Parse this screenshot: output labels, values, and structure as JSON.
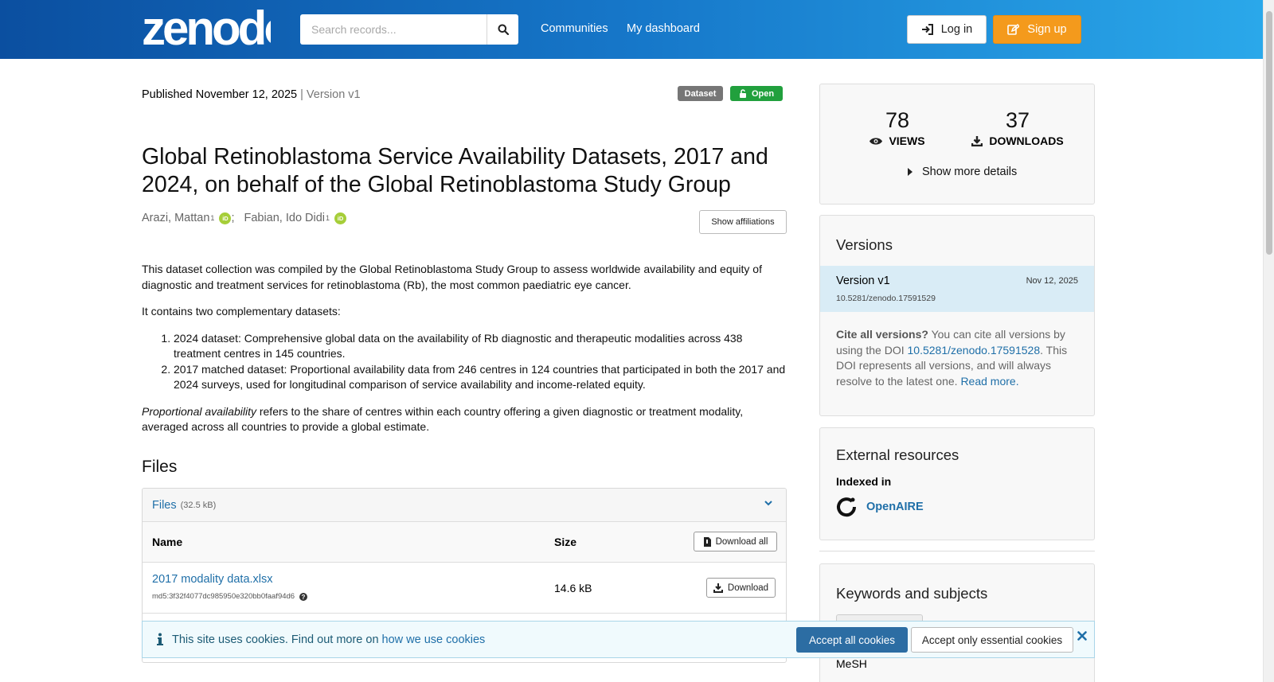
{
  "header": {
    "logo_text": "zenodo",
    "search_placeholder": "Search records...",
    "nav": [
      "Communities",
      "My dashboard"
    ],
    "login_label": "Log in",
    "signup_label": "Sign up"
  },
  "record": {
    "published_prefix": "Published",
    "published_date": "November 12, 2025",
    "version_text": "| Version v1",
    "badge_type": "Dataset",
    "badge_access": "Open",
    "title": "Global Retinoblastoma Service Availability Datasets, 2017 and 2024, on behalf of the Global Retinoblastoma Study Group",
    "creators": [
      {
        "name": "Arazi, Mattan",
        "affil": "1",
        "sep": ";"
      },
      {
        "name": "Fabian, Ido Didi",
        "affil": "1",
        "sep": ""
      }
    ],
    "show_affiliations_label": "Show affiliations",
    "description": {
      "p1": "This dataset collection was compiled by the Global Retinoblastoma Study Group to assess worldwide availability and equity of diagnostic and treatment services for retinoblastoma (Rb), the most common paediatric eye cancer.",
      "p2": "It contains two complementary datasets:",
      "list": [
        "2024 dataset: Comprehensive global data on the availability of Rb diagnostic and therapeutic modalities across 438 treatment centres in 145 countries.",
        "2017 matched dataset: Proportional availability data from 246 centres in 124 countries that participated in both the 2017 and 2024 surveys, used for longitudinal comparison of service availability and income-related equity."
      ],
      "p3_em": "Proportional availability",
      "p3_rest": " refers to the share of centres within each country offering a given diagnostic or treatment modality, averaged across all countries to provide a global estimate."
    }
  },
  "files": {
    "heading": "Files",
    "panel_label": "Files",
    "panel_size": "(32.5 kB)",
    "col_name": "Name",
    "col_size": "Size",
    "download_all_label": "Download all",
    "rows": [
      {
        "name": "2017 modality data.xlsx",
        "md5": "md5:3f32f4077dc985950e320bb0faaf94d6",
        "size": "14.6 kB",
        "download_label": "Download"
      }
    ]
  },
  "stats": {
    "views": "78",
    "views_label": "VIEWS",
    "downloads": "37",
    "downloads_label": "DOWNLOADS",
    "more_label": "Show more details"
  },
  "versions": {
    "heading": "Versions",
    "current_name": "Version v1",
    "current_date": "Nov 12, 2025",
    "current_doi": "10.5281/zenodo.17591529",
    "cite_bold": "Cite all versions?",
    "cite_text1": " You can cite all versions by using the DOI ",
    "cite_doi": "10.5281/zenodo.17591528",
    "cite_text2": ". This DOI represents all versions, and will always resolve to the latest one. ",
    "read_more": "Read more."
  },
  "external": {
    "heading": "External resources",
    "indexed_label": "Indexed in",
    "source_name": "OpenAIRE"
  },
  "keywords": {
    "heading": "Keywords and subjects",
    "mesh_label": "MeSH"
  },
  "cookie": {
    "text": "This site uses cookies. Find out more on ",
    "link": "how we use cookies",
    "accept_all": "Accept all cookies",
    "accept_essential": "Accept only essential cookies"
  },
  "colors": {
    "header_start": "#0b4fa0",
    "header_end": "#2aa8ea",
    "signup": "#f49a1c",
    "open_badge": "#21a03d",
    "link": "#1f6fa8"
  }
}
